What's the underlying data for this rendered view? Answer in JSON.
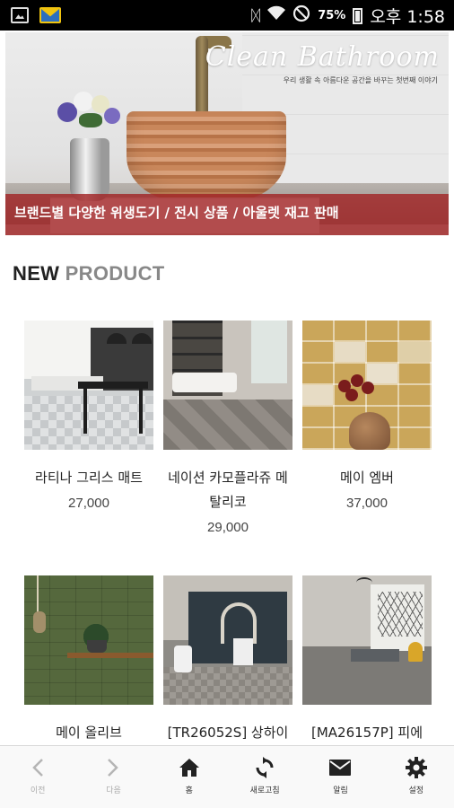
{
  "status_bar": {
    "battery_percent": "75%",
    "clock": "오후 1:58",
    "icons": [
      "image-icon",
      "mail-notification-icon",
      "vibrate-icon",
      "wifi-icon",
      "do-not-disturb-icon",
      "battery-icon"
    ]
  },
  "banner": {
    "script_title": "Clean Bathroom",
    "subtitle": "우리 생활 속 아름다운 공간을 바꾸는 첫번째 이야기",
    "strip_text": "브랜드별 다양한 위생도기 / 전시 상품 / 아울렛 재고 판매",
    "strip_color": "#a12426"
  },
  "section": {
    "title_part1": "NEW",
    "title_part2": "PRODUCT"
  },
  "products": [
    {
      "name": "라티나 그리스 매트",
      "price": "27,000"
    },
    {
      "name": "네이션 카모플라쥬 메 탈리코",
      "price": "29,000"
    },
    {
      "name": "메이 엠버",
      "price": "37,000"
    },
    {
      "name": "메이 올리브",
      "price": ""
    },
    {
      "name": "[TR26052S] 상하이",
      "price": ""
    },
    {
      "name": "[MA26157P] 피에",
      "price": ""
    }
  ],
  "bottom_nav": [
    {
      "label": "이전",
      "icon": "chevron-left-icon",
      "enabled": false
    },
    {
      "label": "다음",
      "icon": "chevron-right-icon",
      "enabled": false
    },
    {
      "label": "홈",
      "icon": "home-icon",
      "enabled": true
    },
    {
      "label": "새로고침",
      "icon": "refresh-icon",
      "enabled": true
    },
    {
      "label": "알림",
      "icon": "mail-icon",
      "enabled": true
    },
    {
      "label": "설정",
      "icon": "gear-icon",
      "enabled": true
    }
  ]
}
